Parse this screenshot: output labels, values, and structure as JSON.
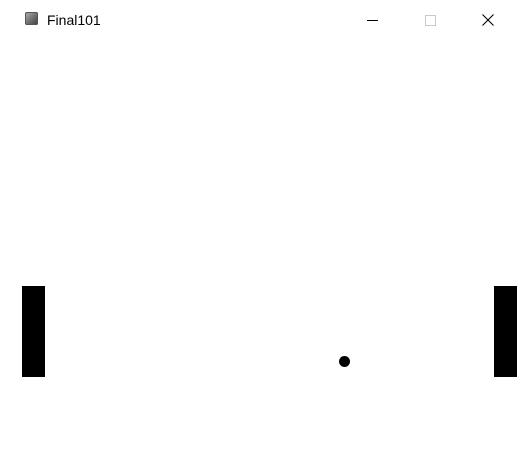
{
  "window": {
    "title": "Final101",
    "app_icon": "app-icon",
    "controls": {
      "minimize_icon": "minimize-icon",
      "maximize_icon": "maximize-icon",
      "close_icon": "close-icon"
    }
  },
  "game": {
    "background": "#ffffff",
    "paddle_color": "#000000",
    "ball_color": "#000000"
  }
}
